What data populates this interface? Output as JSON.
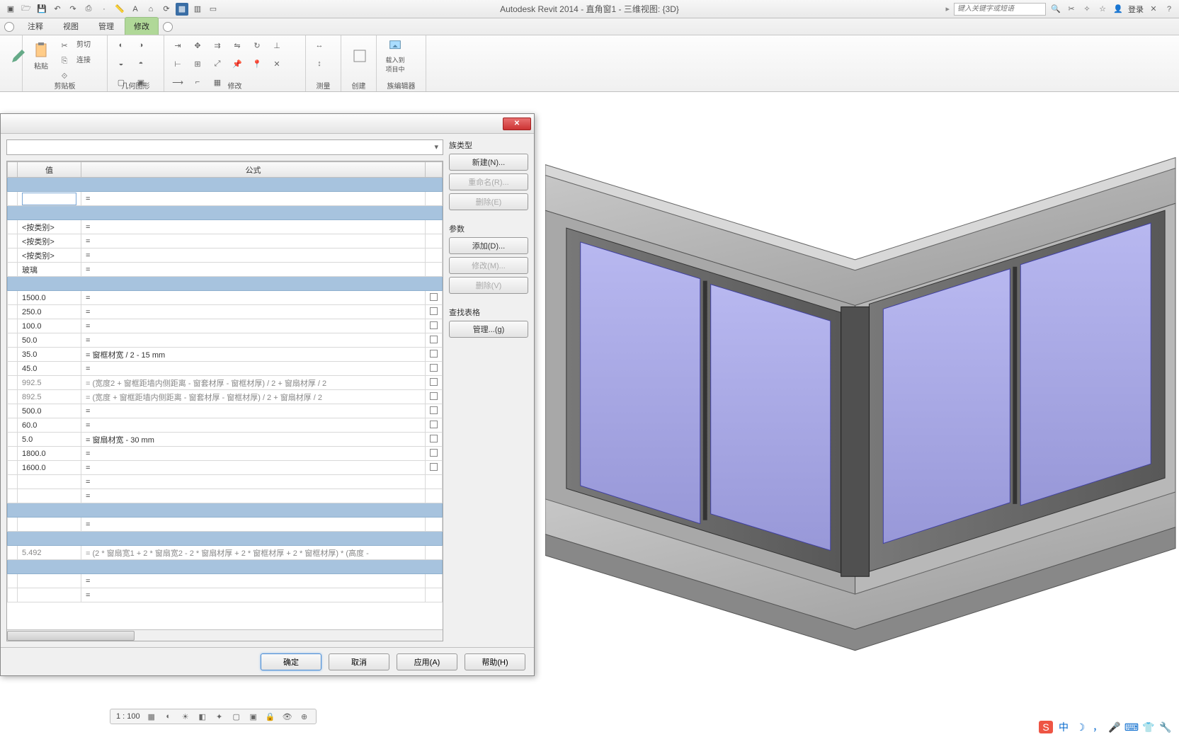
{
  "title": "Autodesk Revit 2014 -     直角窗1 - 三维视图: {3D}",
  "search_placeholder": "键入关键字或短语",
  "login": "登录",
  "tabs": {
    "t1": "注释",
    "t2": "视图",
    "t3": "管理",
    "t4": "修改"
  },
  "panels": {
    "clipboard": {
      "label": "剪贴板",
      "paste": "粘贴",
      "cut": "剪切",
      "copy": "连接"
    },
    "geometry": {
      "label": "几何图形"
    },
    "modify": {
      "label": "修改"
    },
    "measure": {
      "label": "测量"
    },
    "create": {
      "label": "创建"
    },
    "family": {
      "label": "族编辑器",
      "load": "载入到\n项目中"
    }
  },
  "dialog": {
    "headers": {
      "value": "值",
      "formula": "公式"
    },
    "rows": [
      {
        "type": "cat"
      },
      {
        "type": "edit",
        "val": "",
        "f": "="
      },
      {
        "type": "cat"
      },
      {
        "type": "data",
        "val": "<按类别>",
        "f": "="
      },
      {
        "type": "data",
        "val": "<按类别>",
        "f": "="
      },
      {
        "type": "data",
        "val": "<按类别>",
        "f": "="
      },
      {
        "type": "data",
        "val": "玻璃",
        "f": "="
      },
      {
        "type": "cat"
      },
      {
        "type": "data",
        "val": "1500.0",
        "f": "=",
        "chk": true
      },
      {
        "type": "data",
        "val": "250.0",
        "f": "=",
        "chk": true
      },
      {
        "type": "data",
        "val": "100.0",
        "f": "=",
        "chk": true
      },
      {
        "type": "data",
        "val": "50.0",
        "f": "=",
        "chk": true
      },
      {
        "type": "data",
        "val": "35.0",
        "f": "= 窗框材宽 / 2 - 15 mm",
        "chk": true
      },
      {
        "type": "data",
        "val": "45.0",
        "f": "=",
        "chk": true
      },
      {
        "type": "data",
        "val": "992.5",
        "f": "= (宽度2 + 窗框距墙内侧距离 - 窗套材厚 - 窗框材厚) / 2 + 窗扇材厚 / 2",
        "chk": true,
        "grey": true
      },
      {
        "type": "data",
        "val": "892.5",
        "f": "= (宽度 + 窗框距墙内侧距离 - 窗套材厚 - 窗框材厚) / 2 + 窗扇材厚 / 2",
        "chk": true,
        "grey": true
      },
      {
        "type": "data",
        "val": "500.0",
        "f": "=",
        "chk": true
      },
      {
        "type": "data",
        "val": "60.0",
        "f": "=",
        "chk": true
      },
      {
        "type": "data",
        "val": "5.0",
        "f": "= 窗扇材宽 - 30 mm",
        "chk": true
      },
      {
        "type": "data",
        "val": "1800.0",
        "f": "=",
        "chk": true
      },
      {
        "type": "data",
        "val": "1600.0",
        "f": "=",
        "chk": true
      },
      {
        "type": "data",
        "val": "",
        "f": "="
      },
      {
        "type": "data",
        "val": "",
        "f": "="
      },
      {
        "type": "cat"
      },
      {
        "type": "data",
        "val": "",
        "f": "="
      },
      {
        "type": "cat"
      },
      {
        "type": "data",
        "val": "5.492",
        "f": "= (2 * 窗扇宽1 + 2 * 窗扇宽2 - 2 * 窗扇材厚 + 2 * 窗框材厚 + 2 * 窗框材厚) * (高度 -",
        "grey": true
      },
      {
        "type": "cat"
      },
      {
        "type": "data",
        "val": "",
        "f": "="
      },
      {
        "type": "data",
        "val": "",
        "f": "="
      }
    ],
    "side": {
      "family_types": "族类型",
      "new": "新建(N)...",
      "rename": "重命名(R)...",
      "delete1": "删除(E)",
      "params": "参数",
      "add": "添加(D)...",
      "modify": "修改(M)...",
      "delete2": "删除(V)",
      "lookup": "查找表格",
      "manage": "管理...(g)"
    },
    "footer": {
      "ok": "确定",
      "cancel": "取消",
      "apply": "应用(A)",
      "help": "帮助(H)"
    }
  },
  "viewbar": {
    "scale": "1 : 100"
  },
  "taskbar": {
    "ime": "中"
  }
}
